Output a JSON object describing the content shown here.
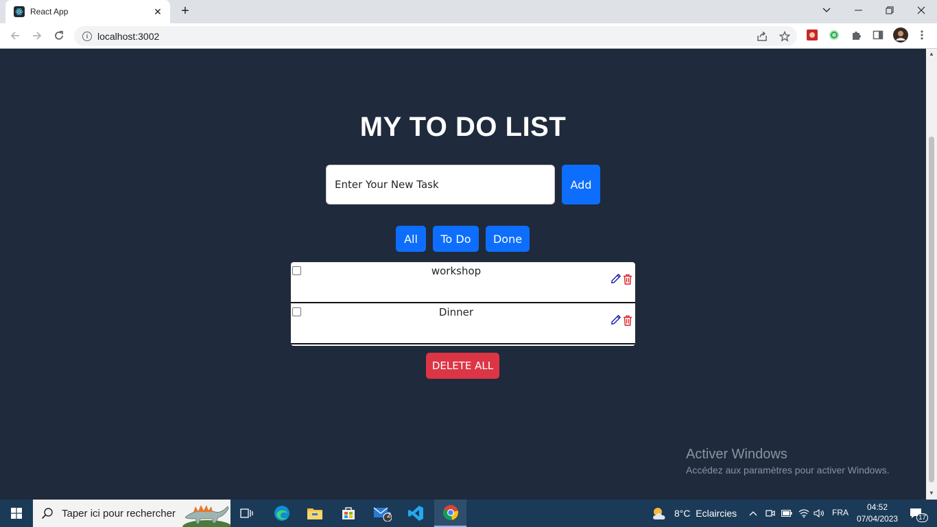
{
  "browser": {
    "tab_title": "React App",
    "tab_close": "✕",
    "new_tab": "+",
    "url": "localhost:3002",
    "info_glyph": "i"
  },
  "app": {
    "title": "MY TO DO LIST",
    "input_placeholder": "Enter Your New Task",
    "add_label": "Add",
    "filters": [
      "All",
      "To Do",
      "Done"
    ],
    "tasks": [
      {
        "text": "workshop",
        "done": false
      },
      {
        "text": "Dinner",
        "done": false
      }
    ],
    "delete_all_label": "DELETE ALL",
    "colors": {
      "primary": "#0d6efd",
      "danger": "#dc3545",
      "background": "#1f2a3c",
      "edit_icon": "#1a1aa8",
      "trash_icon": "#dc1f26"
    }
  },
  "watermark": {
    "title": "Activer Windows",
    "subtitle": "Accédez aux paramètres pour activer Windows."
  },
  "taskbar": {
    "search_placeholder": "Taper ici pour rechercher",
    "mail_badge": "2",
    "weather": "8°C  Eclaircies",
    "language": "FRA",
    "time": "04:52",
    "date": "07/04/2023",
    "notifications": "17"
  }
}
